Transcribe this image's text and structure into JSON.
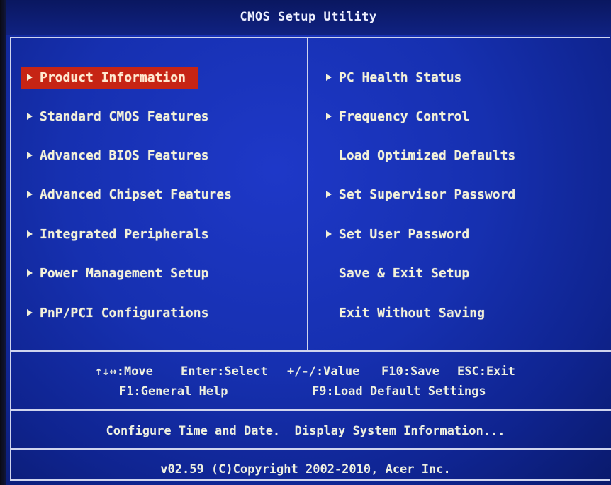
{
  "title": "CMOS Setup Utility",
  "left_menu": [
    {
      "label": "Product Information",
      "arrow": true,
      "selected": true
    },
    {
      "label": "Standard CMOS Features",
      "arrow": true,
      "selected": false
    },
    {
      "label": "Advanced BIOS Features",
      "arrow": true,
      "selected": false
    },
    {
      "label": "Advanced Chipset Features",
      "arrow": true,
      "selected": false
    },
    {
      "label": "Integrated Peripherals",
      "arrow": true,
      "selected": false
    },
    {
      "label": "Power Management Setup",
      "arrow": true,
      "selected": false
    },
    {
      "label": "PnP/PCI Configurations",
      "arrow": true,
      "selected": false
    }
  ],
  "right_menu": [
    {
      "label": "PC Health Status",
      "arrow": true
    },
    {
      "label": "Frequency Control",
      "arrow": true
    },
    {
      "label": "Load Optimized Defaults",
      "arrow": false
    },
    {
      "label": "Set Supervisor Password",
      "arrow": true
    },
    {
      "label": "Set User Password",
      "arrow": true
    },
    {
      "label": "Save & Exit Setup",
      "arrow": false
    },
    {
      "label": "Exit Without Saving",
      "arrow": false
    }
  ],
  "help": {
    "move": "↑↓↔:Move",
    "enter": "Enter:Select",
    "value": "+/-/:Value",
    "f10": "F10:Save",
    "esc": "ESC:Exit",
    "f1": "F1:General Help",
    "f9": "F9:Load Default Settings"
  },
  "description": "Configure Time and Date.  Display System Information...",
  "copyright": "v02.59 (C)Copyright 2002-2010, Acer Inc.",
  "colors": {
    "background": "#1630b0",
    "highlight": "#c62414",
    "text": "#f3f1d9",
    "border": "#cfd4ee"
  }
}
